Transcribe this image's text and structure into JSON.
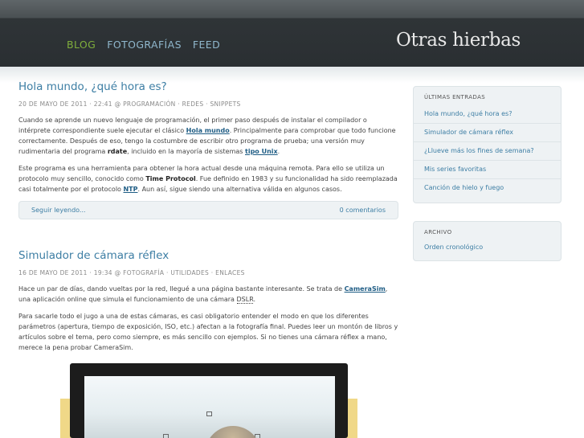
{
  "site": {
    "title": "Otras hierbas"
  },
  "nav": [
    "BLOG",
    "FOTOGRAFÍAS",
    "FEED"
  ],
  "posts": [
    {
      "title": "Hola mundo, ¿qué hora es?",
      "date": "20 de mayo de 2011",
      "time": "22:41",
      "at": "@",
      "tags": [
        "Programación",
        "Redes",
        "Snippets"
      ],
      "p1": [
        "Cuando se aprende un nuevo lenguaje de programación, el primer paso después de instalar el compilador o intérprete correspondiente suele ejecutar el clásico ",
        "Hola mundo",
        ". Principalmente para comprobar que todo funcione correctamente. Después de eso, tengo la costumbre de escribir otro programa de prueba; una versión muy rudimentaria del programa ",
        "rdate",
        ", incluido en la mayoría de sistemas ",
        "tipo Unix",
        "."
      ],
      "p2": [
        "Este programa es una herramienta para obtener la hora actual desde una máquina remota. Para ello se utiliza un protocolo muy sencillo, conocido como ",
        "Time Protocol",
        ". Fue definido en 1983 y su funcionalidad ha sido reemplazada casi totalmente por el protocolo ",
        "NTP",
        ". Aun así, sigue siendo una alternativa válida en algunos casos."
      ],
      "more": "Seguir leyendo...",
      "comments": "0 comentarios"
    },
    {
      "title": "Simulador de cámara réflex",
      "date": "16 de mayo de 2011",
      "time": "19:34",
      "at": "@",
      "tags": [
        "Fotografía",
        "Utilidades",
        "Enlaces"
      ],
      "p1": [
        "Hace un par de días, dando vueltas por la red, llegué a una página bastante interesante. Se trata de ",
        "CameraSim",
        ", una aplicación online que simula el funcionamiento de una cámara ",
        "DSLR",
        "."
      ],
      "p2": "Para sacarle todo el jugo a una de estas cámaras, es casi obligatorio entender el modo en que los diferentes parámetros (apertura, tiempo de exposición, ISO, etc.) afectan a la fotografía final. Puedes leer un montón de libros y artículos sobre el tema, pero como siempre, es más sencillo con ejemplos. Si no tienes una cámara réflex a mano, merece la pena probar CameraSim."
    }
  ],
  "sidebar": {
    "recent": {
      "heading": "Últimas entradas",
      "items": [
        "Hola mundo, ¿qué hora es?",
        "Simulador de cámara réflex",
        "¿Llueve más los fines de semana?",
        "Mis series favoritas",
        "Canción de hielo y fuego"
      ]
    },
    "archive": {
      "heading": "Archivo",
      "items": [
        "Orden cronológico"
      ]
    }
  },
  "colors": {
    "accent": "#7fae3c",
    "link": "#3d7ea4",
    "header": "#2f3437"
  }
}
